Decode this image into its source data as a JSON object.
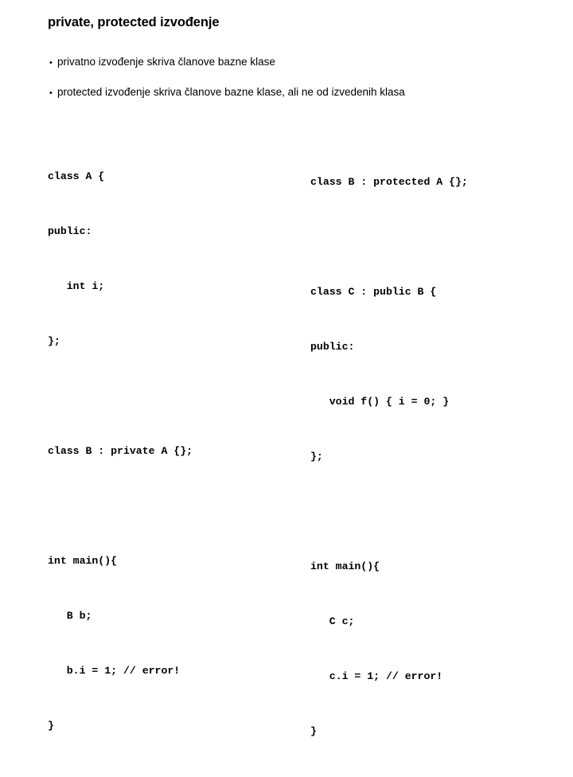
{
  "slide": {
    "title": "private, protected izvođenje",
    "background_color": "#ffffff",
    "text_color": "#000000",
    "bullet_mark": "•",
    "bullets": [
      "privatno izvođenje skriva članove bazne klase",
      "protected izvođenje skriva članove bazne klase, ali ne od izvedenih klasa"
    ],
    "code_left": [
      "class A {",
      "public:",
      "   int i;",
      "};",
      "",
      "class B : private A {};",
      "",
      "int main(){",
      "   B b;",
      "   b.i = 1; // error!",
      "}"
    ],
    "code_right": [
      "class B : protected A {};",
      "",
      "class C : public B {",
      "public:",
      "   void f() { i = 0; }",
      "};",
      "",
      "int main(){",
      "   C c;",
      "   c.i = 1; // error!",
      "}"
    ]
  }
}
